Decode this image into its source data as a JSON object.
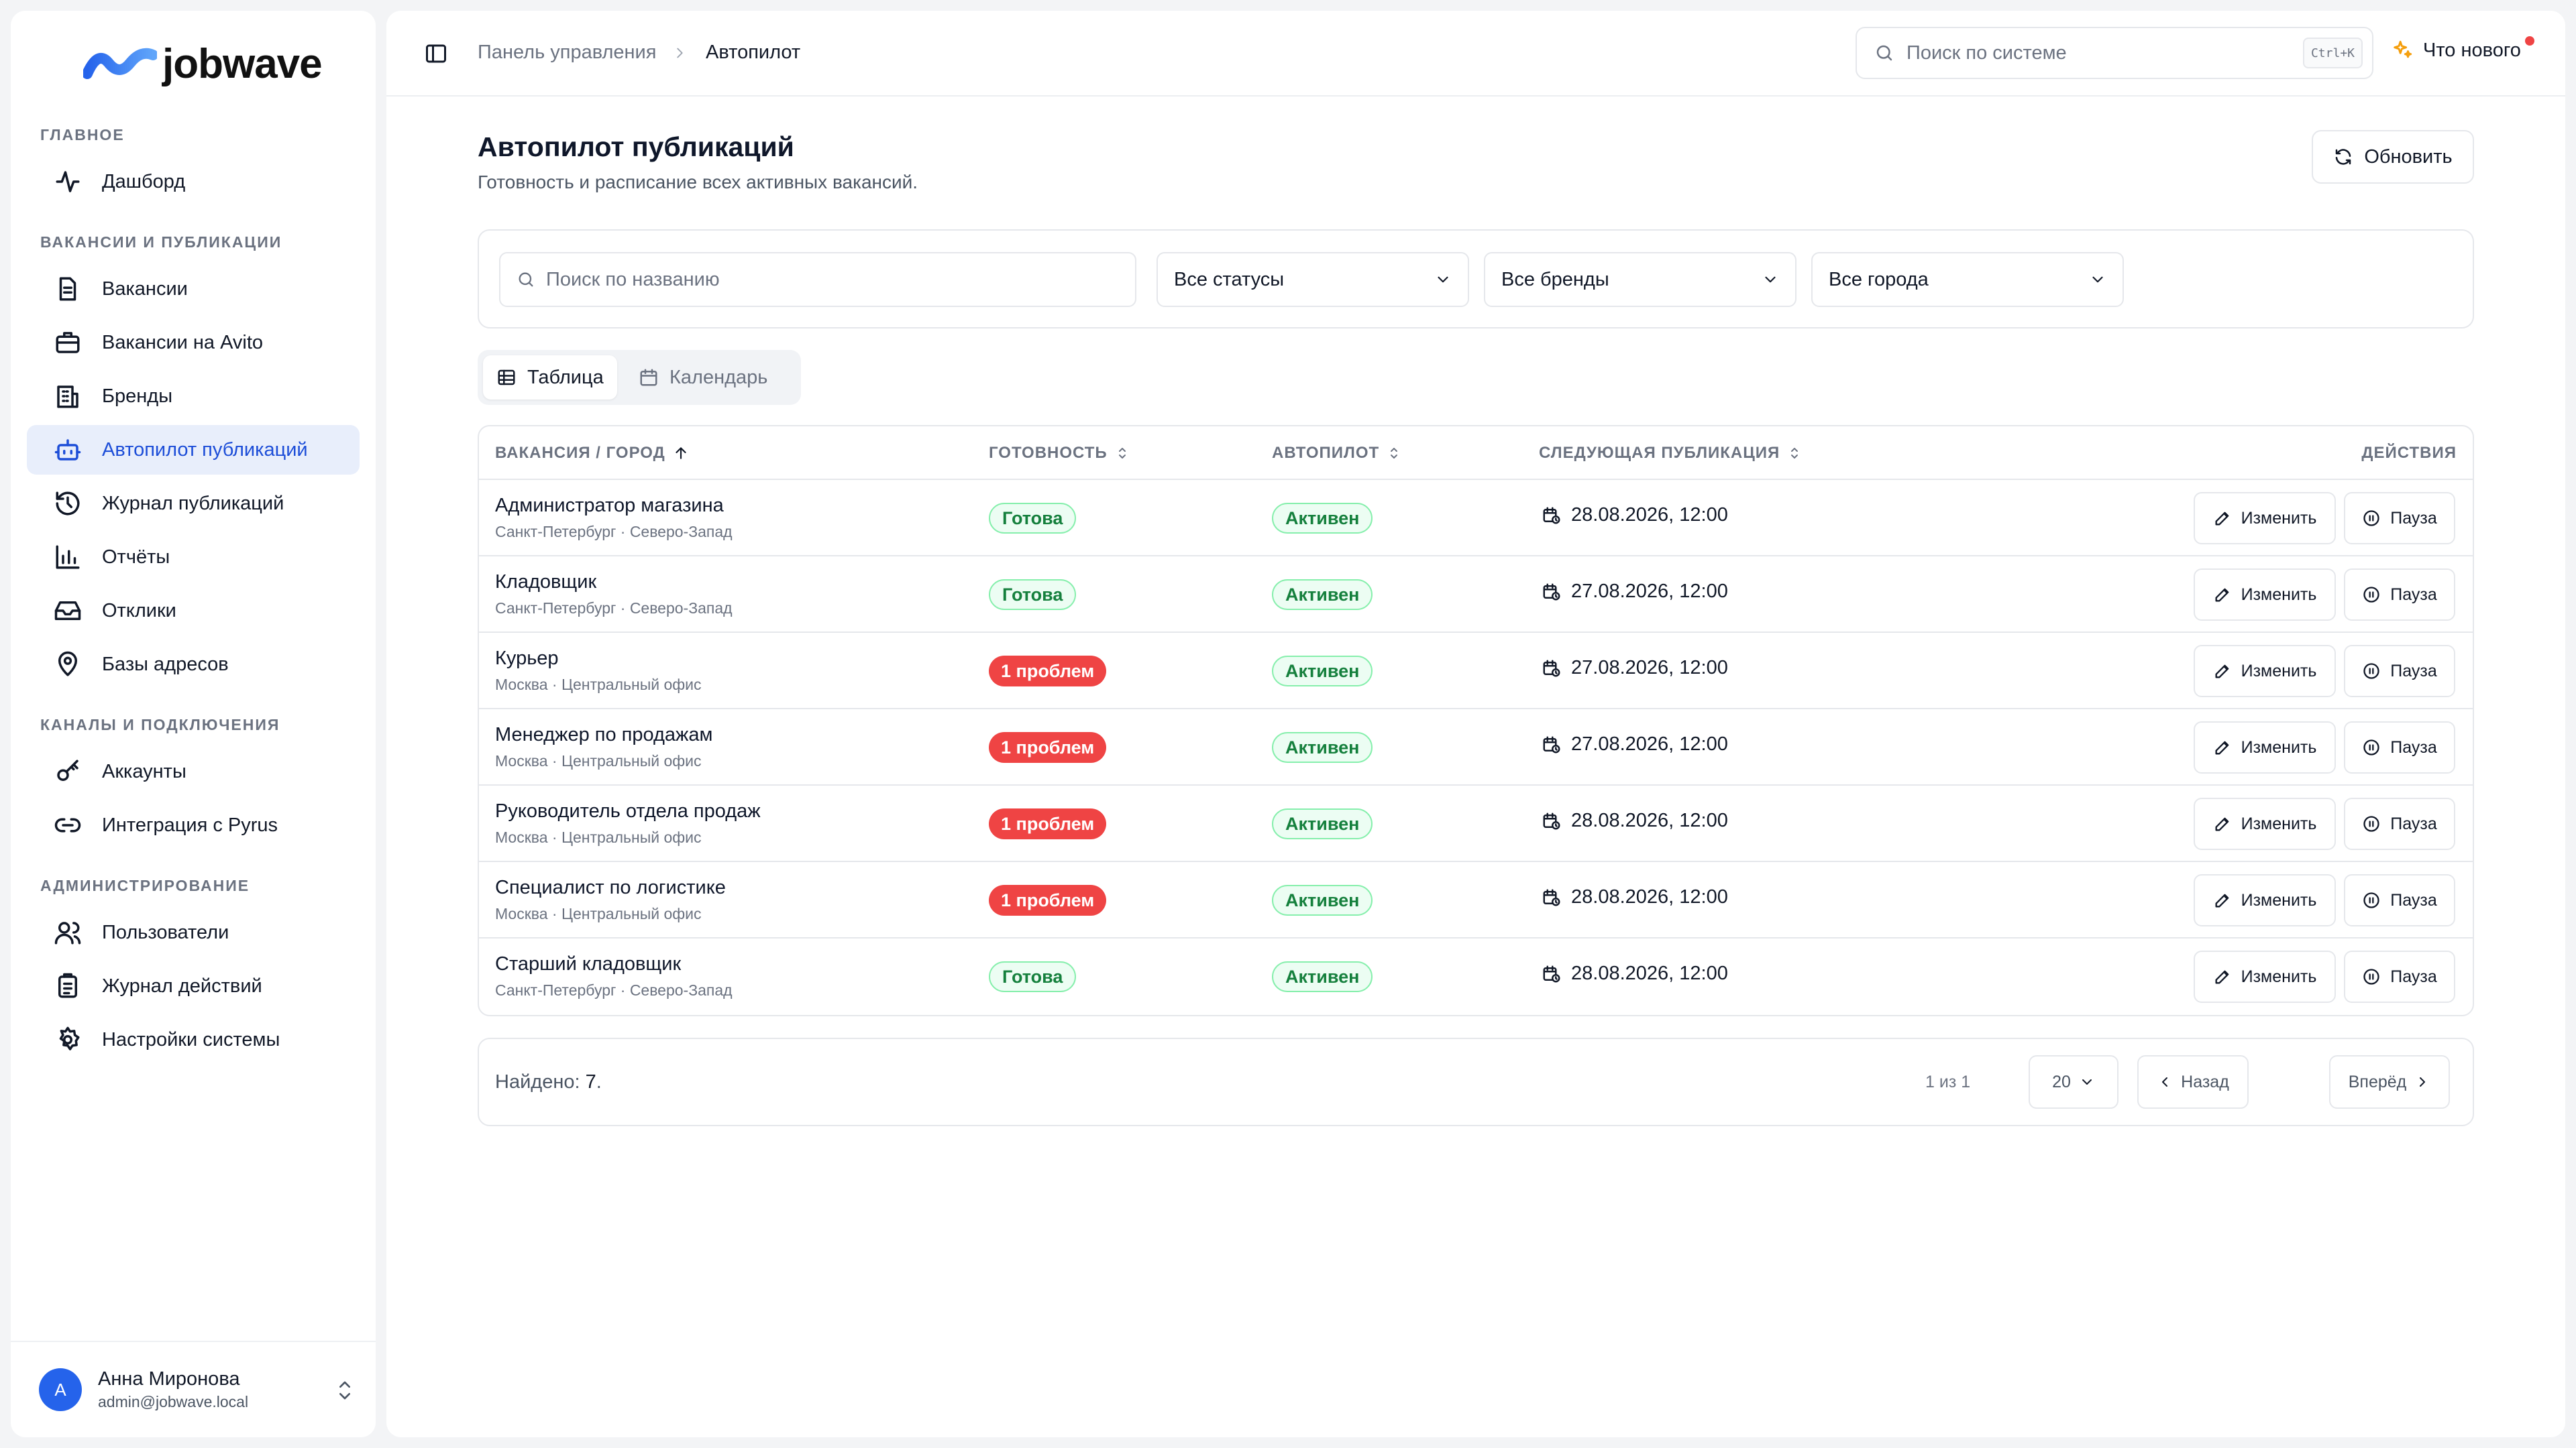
{
  "brand": {
    "name": "jobwave"
  },
  "nav": {
    "sections": [
      {
        "label": "ГЛАВНОЕ"
      },
      {
        "label": "ВАКАНСИИ И ПУБЛИКАЦИИ"
      },
      {
        "label": "КАНАЛЫ И ПОДКЛЮЧЕНИЯ"
      },
      {
        "label": "АДМИНИСТРИРОВАНИЕ"
      }
    ],
    "items": [
      {
        "label": "Дашборд",
        "icon": "activity-icon"
      },
      {
        "label": "Вакансии",
        "icon": "document-icon"
      },
      {
        "label": "Вакансии на Avito",
        "icon": "briefcase-icon"
      },
      {
        "label": "Бренды",
        "icon": "building-icon"
      },
      {
        "label": "Автопилот публикаций",
        "icon": "bot-icon",
        "active": true
      },
      {
        "label": "Журнал публикаций",
        "icon": "history-icon"
      },
      {
        "label": "Отчёты",
        "icon": "bar-chart-icon"
      },
      {
        "label": "Отклики",
        "icon": "inbox-icon"
      },
      {
        "label": "Базы адресов",
        "icon": "map-pin-icon"
      },
      {
        "label": "Аккаунты",
        "icon": "key-icon"
      },
      {
        "label": "Интеграция с Pyrus",
        "icon": "link-icon"
      },
      {
        "label": "Пользователи",
        "icon": "users-icon"
      },
      {
        "label": "Журнал действий",
        "icon": "clipboard-icon"
      },
      {
        "label": "Настройки системы",
        "icon": "gear-icon"
      }
    ]
  },
  "user": {
    "initial": "А",
    "name": "Анна Миронова",
    "email": "admin@jobwave.local"
  },
  "header": {
    "breadcrumb": [
      "Панель управления",
      "Автопилот"
    ],
    "search_placeholder": "Поиск по системе",
    "shortcut": "Ctrl+K",
    "whats_new": "Что нового"
  },
  "page": {
    "title": "Автопилот публикаций",
    "subtitle": "Готовность и расписание всех активных вакансий.",
    "refresh_label": "Обновить"
  },
  "filters": {
    "search_placeholder": "Поиск по названию",
    "status": "Все статусы",
    "brand": "Все бренды",
    "city": "Все города"
  },
  "view_tabs": [
    {
      "label": "Таблица",
      "active": true
    },
    {
      "label": "Календарь",
      "active": false
    }
  ],
  "table": {
    "columns": [
      "ВАКАНСИЯ / ГОРОД",
      "ГОТОВНОСТЬ",
      "АВТОПИЛОТ",
      "СЛЕДУЮЩАЯ ПУБЛИКАЦИЯ",
      "ДЕЙСТВИЯ"
    ],
    "edit_label": "Изменить",
    "pause_label": "Пауза",
    "rows": [
      {
        "title": "Администратор магазина",
        "location": "Санкт-Петербург · Северо-Запад",
        "readiness": "Готова",
        "readiness_type": "ready",
        "autopilot": "Активен",
        "next": "28.08.2026, 12:00"
      },
      {
        "title": "Кладовщик",
        "location": "Санкт-Петербург · Северо-Запад",
        "readiness": "Готова",
        "readiness_type": "ready",
        "autopilot": "Активен",
        "next": "27.08.2026, 12:00"
      },
      {
        "title": "Курьер",
        "location": "Москва · Центральный офис",
        "readiness": "1 проблем",
        "readiness_type": "problem",
        "autopilot": "Активен",
        "next": "27.08.2026, 12:00"
      },
      {
        "title": "Менеджер по продажам",
        "location": "Москва · Центральный офис",
        "readiness": "1 проблем",
        "readiness_type": "problem",
        "autopilot": "Активен",
        "next": "27.08.2026, 12:00"
      },
      {
        "title": "Руководитель отдела продаж",
        "location": "Москва · Центральный офис",
        "readiness": "1 проблем",
        "readiness_type": "problem",
        "autopilot": "Активен",
        "next": "28.08.2026, 12:00"
      },
      {
        "title": "Специалист по логистике",
        "location": "Москва · Центральный офис",
        "readiness": "1 проблем",
        "readiness_type": "problem",
        "autopilot": "Активен",
        "next": "28.08.2026, 12:00"
      },
      {
        "title": "Старший кладовщик",
        "location": "Санкт-Петербург · Северо-Запад",
        "readiness": "Готова",
        "readiness_type": "ready",
        "autopilot": "Активен",
        "next": "28.08.2026, 12:00"
      }
    ]
  },
  "pagination": {
    "found_label": "Найдено:",
    "found_count": "7",
    "page_size": "20",
    "prev": "Назад",
    "info": "1 из 1",
    "next": "Вперёд"
  },
  "colors": {
    "accent": "#1d4ed8",
    "ready": "#15803d",
    "problem": "#ef4444"
  }
}
